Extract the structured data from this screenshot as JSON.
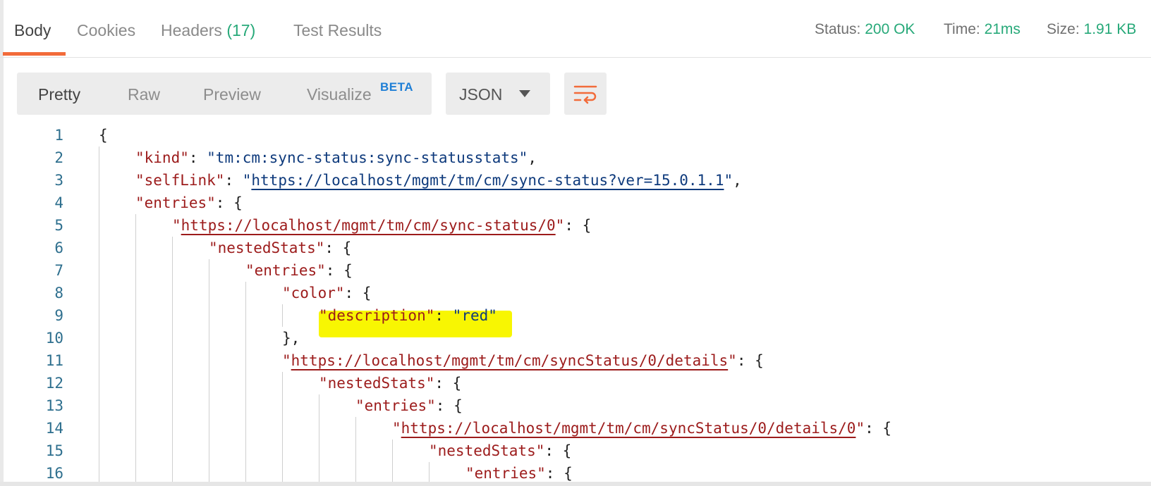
{
  "tabs": [
    {
      "label": "Body",
      "active": true
    },
    {
      "label": "Cookies",
      "active": false
    },
    {
      "label": "Headers",
      "count": "(17)",
      "active": false
    },
    {
      "label": "Test Results",
      "active": false
    }
  ],
  "status": {
    "status_label": "Status:",
    "status_value": "200 OK",
    "time_label": "Time:",
    "time_value": "21ms",
    "size_label": "Size:",
    "size_value": "1.91 KB"
  },
  "view_modes": [
    {
      "label": "Pretty",
      "active": true
    },
    {
      "label": "Raw",
      "active": false
    },
    {
      "label": "Preview",
      "active": false
    },
    {
      "label": "Visualize",
      "badge": "BETA",
      "active": false
    }
  ],
  "format": {
    "selected": "JSON"
  },
  "icons": {
    "wrap": "wrap-lines-icon",
    "dropdown": "chevron-down-icon"
  },
  "colors": {
    "accent": "#f26b3a",
    "success": "#27a979",
    "beta": "#1f7fd6",
    "highlight": "#f8f602"
  },
  "code_lines": [
    {
      "n": "1",
      "parts": [
        {
          "t": "{",
          "c": "punc"
        }
      ]
    },
    {
      "n": "2",
      "parts": [
        {
          "t": "\"kind\"",
          "c": "key"
        },
        {
          "t": ": ",
          "c": "punc"
        },
        {
          "t": "\"tm:cm:sync-status:sync-statusstats\"",
          "c": "str"
        },
        {
          "t": ",",
          "c": "punc"
        }
      ]
    },
    {
      "n": "3",
      "parts": [
        {
          "t": "\"selfLink\"",
          "c": "key"
        },
        {
          "t": ": ",
          "c": "punc"
        },
        {
          "t": "\"",
          "c": "str"
        },
        {
          "t": "https://localhost/mgmt/tm/cm/sync-status?ver=15.0.1.1",
          "c": "url"
        },
        {
          "t": "\"",
          "c": "str"
        },
        {
          "t": ",",
          "c": "punc"
        }
      ]
    },
    {
      "n": "4",
      "parts": [
        {
          "t": "\"entries\"",
          "c": "key"
        },
        {
          "t": ": {",
          "c": "punc"
        }
      ]
    },
    {
      "n": "5",
      "parts": [
        {
          "t": "\"",
          "c": "key"
        },
        {
          "t": "https://localhost/mgmt/tm/cm/sync-status/0",
          "c": "urlkey"
        },
        {
          "t": "\"",
          "c": "key"
        },
        {
          "t": ": {",
          "c": "punc"
        }
      ]
    },
    {
      "n": "6",
      "parts": [
        {
          "t": "\"nestedStats\"",
          "c": "key"
        },
        {
          "t": ": {",
          "c": "punc"
        }
      ]
    },
    {
      "n": "7",
      "parts": [
        {
          "t": "\"entries\"",
          "c": "key"
        },
        {
          "t": ": {",
          "c": "punc"
        }
      ]
    },
    {
      "n": "8",
      "parts": [
        {
          "t": "\"color\"",
          "c": "key"
        },
        {
          "t": ": {",
          "c": "punc"
        }
      ]
    },
    {
      "n": "9",
      "parts": [
        {
          "t": "\"description\"",
          "c": "key"
        },
        {
          "t": ": ",
          "c": "punc"
        },
        {
          "t": "\"red\"",
          "c": "str"
        }
      ]
    },
    {
      "n": "10",
      "parts": [
        {
          "t": "},",
          "c": "punc"
        }
      ]
    },
    {
      "n": "11",
      "parts": [
        {
          "t": "\"",
          "c": "key"
        },
        {
          "t": "https://localhost/mgmt/tm/cm/syncStatus/0/details",
          "c": "urlkey"
        },
        {
          "t": "\"",
          "c": "key"
        },
        {
          "t": ": {",
          "c": "punc"
        }
      ]
    },
    {
      "n": "12",
      "parts": [
        {
          "t": "\"nestedStats\"",
          "c": "key"
        },
        {
          "t": ": {",
          "c": "punc"
        }
      ]
    },
    {
      "n": "13",
      "parts": [
        {
          "t": "\"entries\"",
          "c": "key"
        },
        {
          "t": ": {",
          "c": "punc"
        }
      ]
    },
    {
      "n": "14",
      "parts": [
        {
          "t": "\"",
          "c": "key"
        },
        {
          "t": "https://localhost/mgmt/tm/cm/syncStatus/0/details/0",
          "c": "urlkey"
        },
        {
          "t": "\"",
          "c": "key"
        },
        {
          "t": ": {",
          "c": "punc"
        }
      ]
    },
    {
      "n": "15",
      "parts": [
        {
          "t": "\"nestedStats\"",
          "c": "key"
        },
        {
          "t": ": {",
          "c": "punc"
        }
      ]
    },
    {
      "n": "16",
      "parts": [
        {
          "t": "\"entries\"",
          "c": "key"
        },
        {
          "t": ": {",
          "c": "punc"
        }
      ]
    }
  ]
}
